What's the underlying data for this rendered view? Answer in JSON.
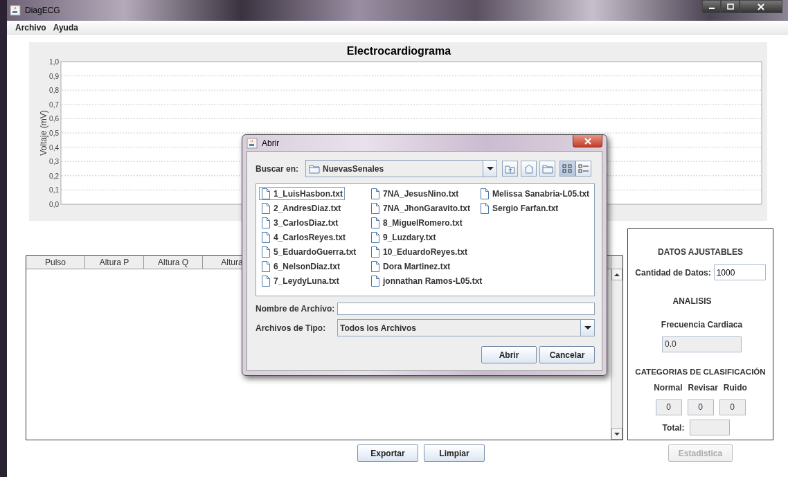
{
  "window": {
    "title": "DiagECG"
  },
  "menu": [
    {
      "label": "Archivo"
    },
    {
      "label": "Ayuda"
    }
  ],
  "chart": {
    "title": "Electrocardiograma",
    "y_axis_label": "Voltaje (mV)",
    "y_tick_labels": [
      "1,0",
      "0,9",
      "0,8",
      "0,7",
      "0,6",
      "0,5",
      "0,4",
      "0,3",
      "0,2",
      "0,1",
      "0,0"
    ]
  },
  "table": {
    "columns": [
      "Pulso",
      "Altura P",
      "Altura Q",
      "Altura"
    ]
  },
  "buttons": [
    {
      "label": "Exportar"
    },
    {
      "label": "Limpiar"
    }
  ],
  "settings": {
    "heading": "DATOS AJUSTABLES",
    "data_count_label": "Cantidad de Datos:",
    "data_count_value": "1000",
    "analysis_heading": "ANALISIS",
    "heart_rate_label": "Frecuencia Cardiaca",
    "heart_rate_value": "0.0",
    "categories_heading": "CATEGORIAS DE CLASIFICACIÓN",
    "categories": [
      {
        "label": "Normal",
        "value": "0"
      },
      {
        "label": "Revisar",
        "value": "0"
      },
      {
        "label": "Ruido",
        "value": "0"
      }
    ],
    "total_label": "Total:",
    "stats_button": {
      "label": "Estadistica",
      "disabled": true
    }
  },
  "dialog": {
    "title": "Abrir",
    "look_in_label": "Buscar en:",
    "look_in_value": "NuevasSenales",
    "view_modes": [
      {
        "kind": "list",
        "selected": true
      },
      {
        "kind": "details",
        "selected": false
      }
    ],
    "files": [
      {
        "name": "1_LuisHasbon.txt",
        "selected": true
      },
      {
        "name": "2_AndresDiaz.txt",
        "selected": false
      },
      {
        "name": "3_CarlosDiaz.txt",
        "selected": false
      },
      {
        "name": "4_CarlosReyes.txt",
        "selected": false
      },
      {
        "name": "5_EduardoGuerra.txt",
        "selected": false
      },
      {
        "name": "6_NelsonDiaz.txt",
        "selected": false
      },
      {
        "name": "7_LeydyLuna.txt",
        "selected": false
      },
      {
        "name": "7NA_JesusNino.txt",
        "selected": false
      },
      {
        "name": "7NA_JhonGaravito.txt",
        "selected": false
      },
      {
        "name": "8_MiguelRomero.txt",
        "selected": false
      },
      {
        "name": "9_Luzdary.txt",
        "selected": false
      },
      {
        "name": "10_EduardoReyes.txt",
        "selected": false
      },
      {
        "name": "Dora Martinez.txt",
        "selected": false
      },
      {
        "name": "jonnathan Ramos-L05.txt",
        "selected": false
      },
      {
        "name": "Melissa Sanabria-L05.txt",
        "selected": false
      },
      {
        "name": "Sergio Farfan.txt",
        "selected": false
      }
    ],
    "file_name_label": "Nombre de Archivo:",
    "file_type_label": "Archivos de Tipo:",
    "file_type_value": "Todos los Archivos",
    "buttons": [
      {
        "label": "Abrir"
      },
      {
        "label": "Cancelar"
      }
    ]
  }
}
